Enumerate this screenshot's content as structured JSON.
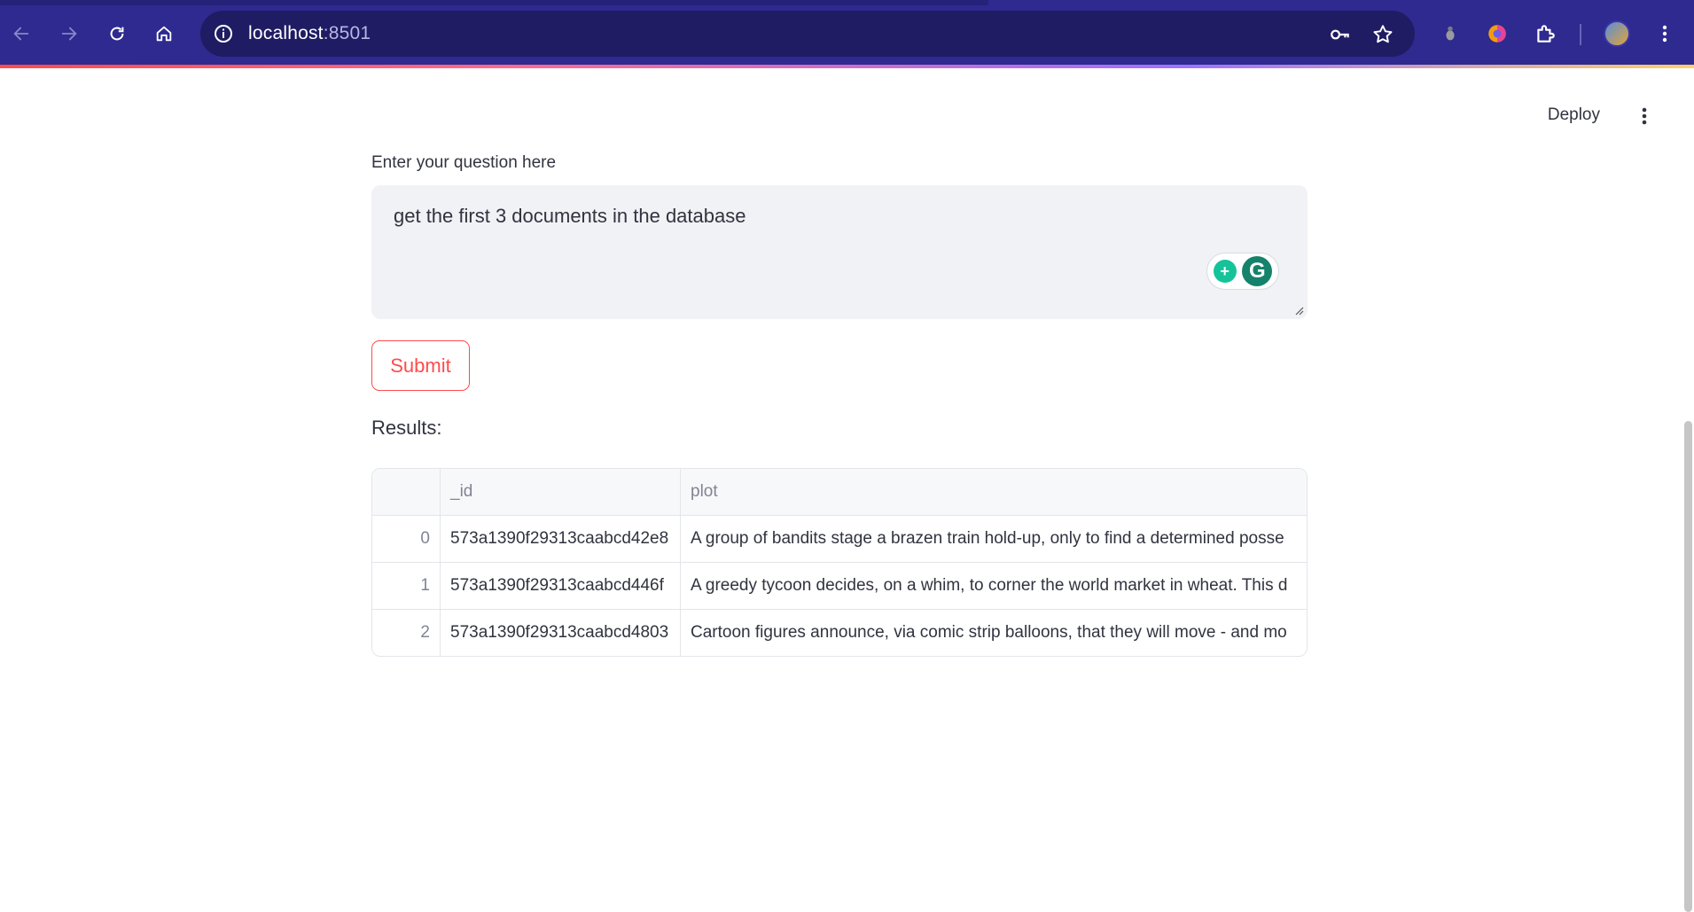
{
  "browser": {
    "url_host": "localhost",
    "url_port": ":8501"
  },
  "header": {
    "deploy_label": "Deploy"
  },
  "form": {
    "question_label": "Enter your question here",
    "question_value": "get the first 3 documents in the database",
    "submit_label": "Submit"
  },
  "results": {
    "label": "Results:",
    "columns": [
      "",
      "_id",
      "plot"
    ],
    "rows": [
      {
        "index": "0",
        "id": "573a1390f29313caabcd42e8",
        "plot": "A group of bandits stage a brazen train hold-up, only to find a determined posse"
      },
      {
        "index": "1",
        "id": "573a1390f29313caabcd446f",
        "plot": "A greedy tycoon decides, on a whim, to corner the world market in wheat. This d"
      },
      {
        "index": "2",
        "id": "573a1390f29313caabcd4803",
        "plot": "Cartoon figures announce, via comic strip balloons, that they will move - and mo"
      }
    ]
  },
  "colors": {
    "accent": "#ff4b4b",
    "chrome": "#2e2a8f",
    "input_bg": "#f0f2f6"
  }
}
